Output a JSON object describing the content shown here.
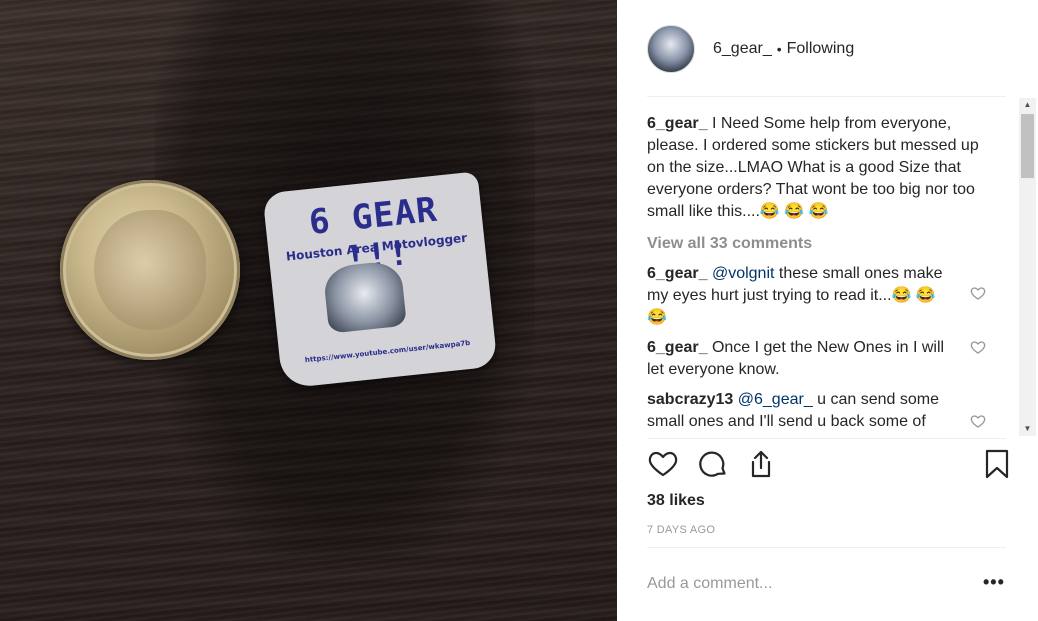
{
  "post": {
    "username": "6_gear_",
    "follow_status": "Following",
    "separator": "•",
    "caption": "I Need Some help from everyone, please. I ordered some stickers but messed up on the size...LMAO What is a good Size that everyone orders? That wont be too big nor too small like this....😂 😂 😂",
    "view_all_comments": "View all 33 comments",
    "comments": [
      {
        "user": "6_gear_",
        "mention": "@volgnit",
        "text": " these small ones make my eyes hurt just trying to read it...😂 😂😂"
      },
      {
        "user": "6_gear_",
        "mention": "",
        "text": "Once I get the New Ones in I will let everyone know."
      },
      {
        "user": "sabcrazy13",
        "mention": "@6_gear_",
        "text": " u can send some small ones and I'll send u back some of"
      }
    ],
    "likes": "38 likes",
    "time_ago": "7 DAYS AGO",
    "add_comment_placeholder": "Add a comment...",
    "more_options": "•••"
  },
  "sticker": {
    "title": "6 GEAR !!!",
    "subtitle": "Houston Area Motovlogger",
    "url": "https://www.youtube.com/user/wkawpa7b"
  },
  "icons": {
    "like": "heart-icon",
    "comment": "comment-icon",
    "share": "share-icon",
    "save": "bookmark-icon"
  },
  "colors": {
    "panel_bg": "#ffffff",
    "text": "#262626",
    "muted": "#8e8e8e",
    "mention": "#003569"
  }
}
